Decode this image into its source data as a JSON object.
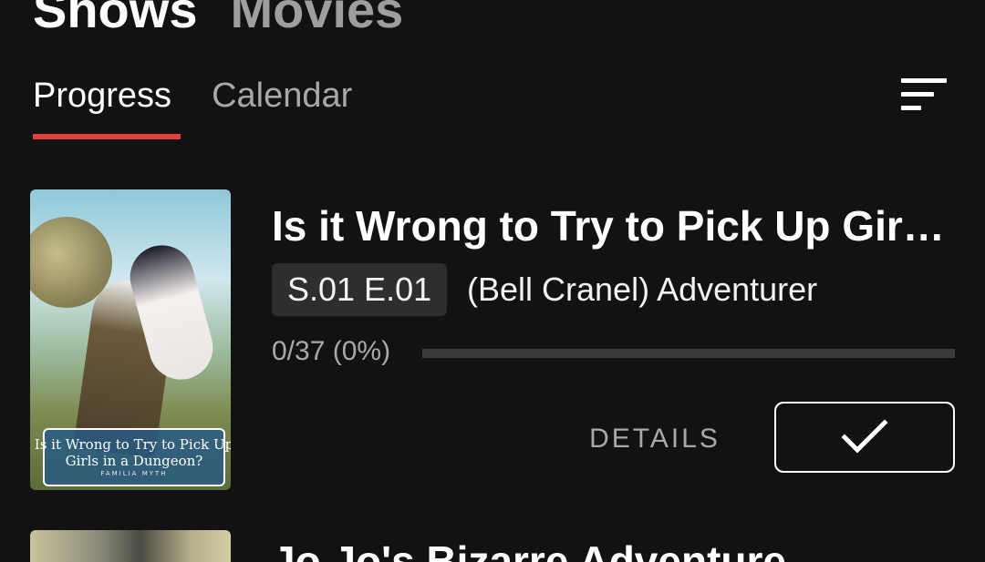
{
  "sections": {
    "shows": "Shows",
    "movies": "Movies"
  },
  "subtabs": {
    "progress": "Progress",
    "calendar": "Calendar"
  },
  "icons": {
    "sort": "sort-icon",
    "check": "check-icon"
  },
  "colors": {
    "background": "#121212",
    "accent": "#e0403a",
    "badge": "#2e2e2e",
    "muted_text": "#a9a9a9"
  },
  "shows": [
    {
      "title": "Is it Wrong to Try to Pick Up Girls in a Dungeon?",
      "episode_badge": "S.01 E.01",
      "episode_title": "(Bell Cranel) Adventurer",
      "progress_text": "0/37 (0%)",
      "progress_percent": 0,
      "details_label": "DETAILS",
      "poster": {
        "logo_line1": "Is it Wrong to Try to Pick Up",
        "logo_line2": "Girls in a Dungeon?",
        "logo_sub": "FAMILIA MYTH"
      }
    },
    {
      "title": "Jo Jo's Bizarre Adventure"
    }
  ]
}
